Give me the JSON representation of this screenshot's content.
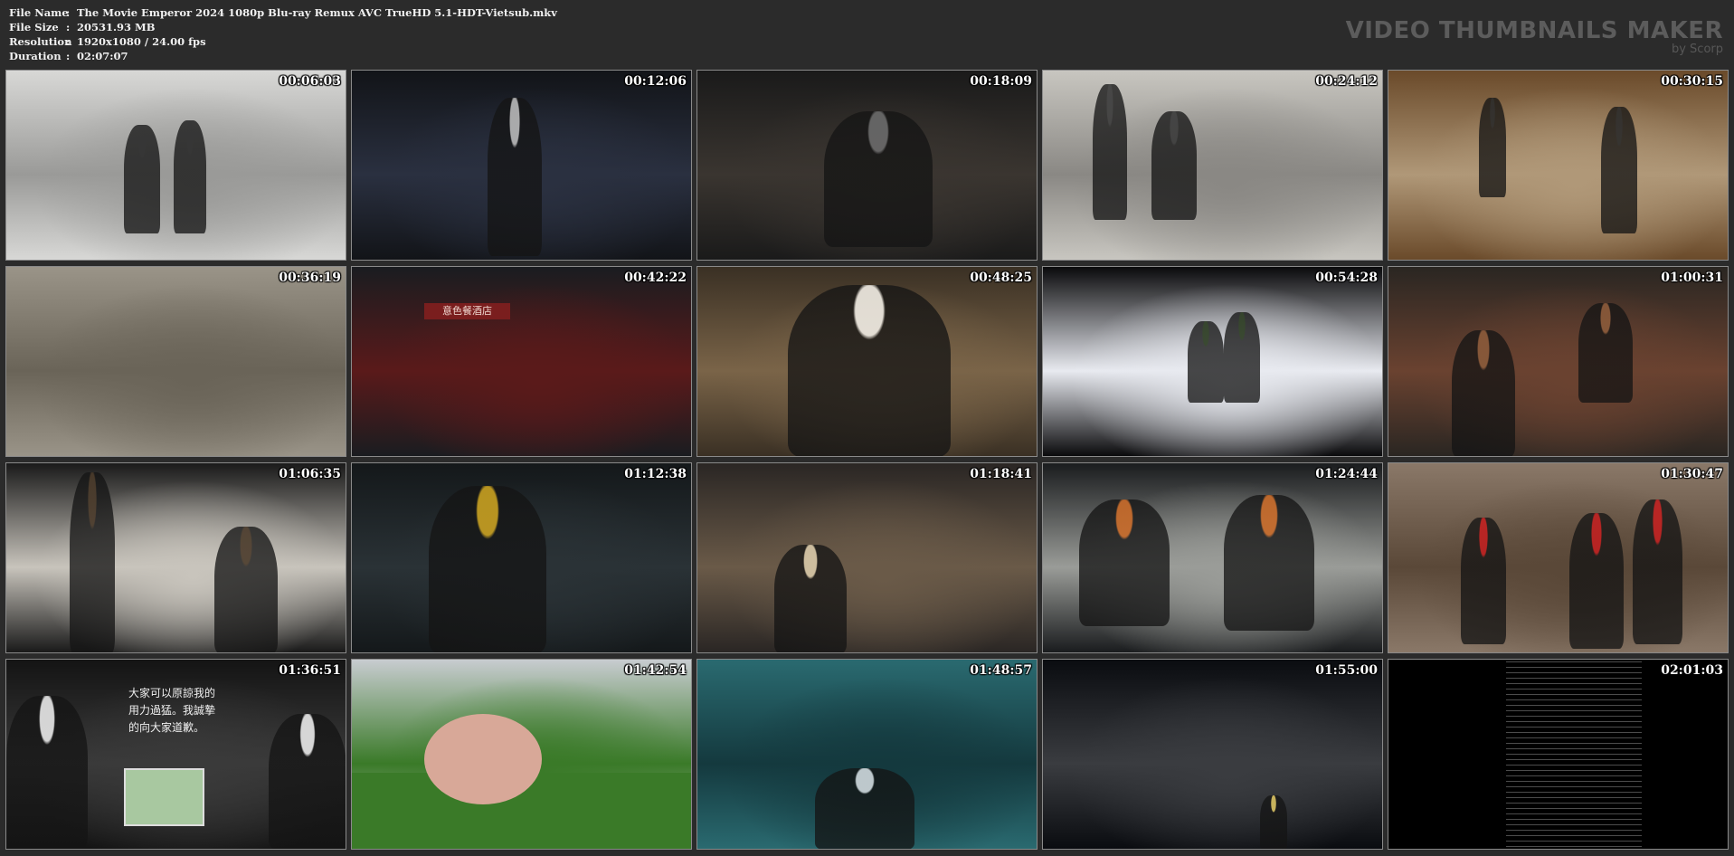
{
  "info": {
    "rows": [
      {
        "label": "File Name",
        "value": "The Movie Emperor 2024 1080p Blu-ray Remux AVC TrueHD 5.1-HDT-Vietsub.mkv"
      },
      {
        "label": "File Size",
        "value": "20531.93 MB"
      },
      {
        "label": "Resolution",
        "value": "1920x1080 / 24.00 fps"
      },
      {
        "label": "Duration",
        "value": "02:07:07"
      }
    ],
    "separator": ":"
  },
  "brand": {
    "title": "VIDEO THUMBNAILS MAKER",
    "subtitle": "by Scorp"
  },
  "thumbnails": [
    {
      "time": "00:06:03",
      "scene": "photo-studio",
      "colors": [
        "#d8d8d6",
        "#9a9a98",
        "#2a2a2a"
      ]
    },
    {
      "time": "00:12:06",
      "scene": "award-stage",
      "colors": [
        "#121418",
        "#2a3040",
        "#b8b8b8"
      ]
    },
    {
      "time": "00:18:09",
      "scene": "man-armchair",
      "colors": [
        "#1a1a1a",
        "#3a3530",
        "#6a6a6a"
      ]
    },
    {
      "time": "00:24:12",
      "scene": "corridor",
      "colors": [
        "#c8c6c0",
        "#8a8884",
        "#3a3a3a"
      ]
    },
    {
      "time": "00:30:15",
      "scene": "hotel-hallway",
      "colors": [
        "#6a4a2a",
        "#b09878",
        "#2a2a2a"
      ]
    },
    {
      "time": "00:36:19",
      "scene": "farmyard",
      "colors": [
        "#9a9488",
        "#6a6458",
        "#8a3a2a"
      ]
    },
    {
      "time": "00:42:22",
      "scene": "restaurant-night",
      "colors": [
        "#1a1c20",
        "#5a1a1a",
        "#bcc6d0"
      ]
    },
    {
      "time": "00:48:25",
      "scene": "man-holding-ball",
      "colors": [
        "#3a3024",
        "#7a6448",
        "#f0ece4"
      ]
    },
    {
      "time": "00:54:28",
      "scene": "night-party",
      "colors": [
        "#0a0a0c",
        "#e8eaf0",
        "#2a3a20"
      ]
    },
    {
      "time": "01:00:31",
      "scene": "dim-lounge",
      "colors": [
        "#2a2622",
        "#6a4230",
        "#8a5a3a"
      ]
    },
    {
      "time": "01:06:35",
      "scene": "bus-interior",
      "colors": [
        "#1a1a1a",
        "#c8c4bc",
        "#4a3a2a"
      ]
    },
    {
      "time": "01:12:38",
      "scene": "parking-garage",
      "colors": [
        "#14181a",
        "#2a3236",
        "#c8a020"
      ]
    },
    {
      "time": "01:18:41",
      "scene": "woman-living-room",
      "colors": [
        "#2a2624",
        "#6a5a48",
        "#d8c8a8"
      ]
    },
    {
      "time": "01:24:44",
      "scene": "car-interior",
      "colors": [
        "#1a1c1e",
        "#9a9c98",
        "#c86a28"
      ]
    },
    {
      "time": "01:30:47",
      "scene": "chaotic-set",
      "colors": [
        "#8a7868",
        "#5a4838",
        "#c02020"
      ]
    },
    {
      "time": "01:36:51",
      "scene": "crowd-subtitle",
      "colors": [
        "#141414",
        "#3a3a3a",
        "#e8e8e8"
      ]
    },
    {
      "time": "01:42:54",
      "scene": "pig-on-grass",
      "colors": [
        "#c8ccd0",
        "#3a7a28",
        "#d8a898"
      ]
    },
    {
      "time": "01:48:57",
      "scene": "teal-stairwell",
      "colors": [
        "#2a6a70",
        "#14393e",
        "#d0d8dc"
      ]
    },
    {
      "time": "01:55:00",
      "scene": "city-night",
      "colors": [
        "#0a0c10",
        "#3a3c40",
        "#d8c060"
      ]
    },
    {
      "time": "02:01:03",
      "scene": "end-credits",
      "colors": [
        "#000000",
        "#000000",
        "#8a8a8a"
      ]
    }
  ],
  "subtitle_text": {
    "line1": "大家可以原諒我的",
    "line2": "用力過猛。我誠摯",
    "line3": "的向大家道歉。"
  },
  "restaurant_sign": "意色餐酒店"
}
